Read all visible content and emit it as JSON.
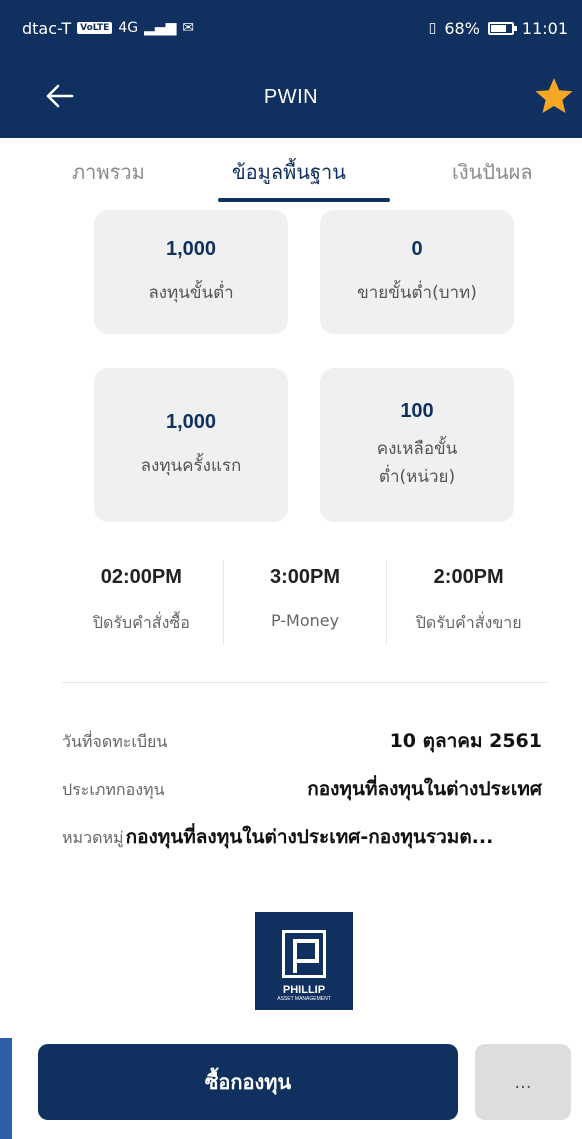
{
  "status_bar": {
    "carrier": "dtac-T",
    "volte": "VoLTE",
    "network": "4G",
    "battery": "68%",
    "time": "11:01"
  },
  "app_bar": {
    "title": "PWIN",
    "back_icon": "arrow-left-icon",
    "favorite_icon": "star-icon",
    "star_color": "#f5a623"
  },
  "tabs": [
    {
      "label": "ภาพรวม",
      "active": false
    },
    {
      "label": "ข้อมูลพื้นฐาน",
      "active": true
    },
    {
      "label": "เงินปันผล",
      "active": false
    }
  ],
  "cards": [
    {
      "value": "1,000",
      "label": "ลงทุนขั้นต่ำ"
    },
    {
      "value": "0",
      "label": "ขายขั้นต่ำ(บาท)"
    },
    {
      "value": "1,000",
      "label": "ลงทุนครั้งแรก"
    },
    {
      "value": "100",
      "label_line1": "คงเหลือขั้น",
      "label_line2": "ต่ำ(หน่วย)"
    }
  ],
  "times": [
    {
      "value": "02:00PM",
      "label": "ปิดรับคำสั่งซื้อ"
    },
    {
      "value": "3:00PM",
      "label": "P-Money"
    },
    {
      "value": "2:00PM",
      "label": "ปิดรับคำสั่งขาย"
    }
  ],
  "info": {
    "registration_date_label": "วันที่จดทะเบียน",
    "registration_date": "10 ตุลาคม 2561",
    "fund_type_label": "ประเภทกองทุน",
    "fund_type": "กองทุนที่ลงทุนในต่างประเทศ",
    "category_label": "หมวดหมู่",
    "category": "กองทุนที่ลงทุนในต่างประเทศ-กองทุนรวมต..."
  },
  "logo": {
    "name": "PHILLIP",
    "sub": "ASSET MANAGEMENT"
  },
  "actions": {
    "buy_label": "ซื้อกองทุน",
    "more_label": "..."
  },
  "colors": {
    "primary": "#10305f",
    "card_bg": "#f0f0f0"
  }
}
